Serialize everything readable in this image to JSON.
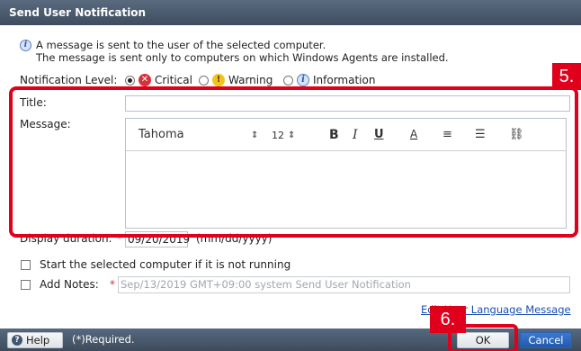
{
  "dialog": {
    "title": "Send User Notification"
  },
  "info": {
    "icon": "info-icon",
    "line1": "A message is sent to the user of the selected computer.",
    "line2": "The message is sent only to computers on which Windows Agents are installed."
  },
  "notification_level": {
    "label": "Notification Level:",
    "options": [
      {
        "label": "Critical",
        "icon": "critical-icon",
        "selected": true
      },
      {
        "label": "Warning",
        "icon": "warning-icon",
        "selected": false
      },
      {
        "label": "Information",
        "icon": "information-icon",
        "selected": false
      }
    ]
  },
  "title_field": {
    "label": "Title:",
    "value": ""
  },
  "message_field": {
    "label": "Message:",
    "toolbar": {
      "font": "Tahoma",
      "font_size": "12",
      "bold": "B",
      "italic": "I",
      "underline": "U",
      "font_color": "A",
      "align_glyph": "≡",
      "list_glyph": "☰",
      "link_glyph": "⛓"
    },
    "body": ""
  },
  "display_duration": {
    "label": "Display duration:",
    "required_mark": "*",
    "value": "09/20/2019",
    "format_hint": "(mm/dd/yyyy)"
  },
  "start_computer": {
    "label": "Start the selected computer if it is not running",
    "checked": false
  },
  "add_notes": {
    "label": "Add Notes:",
    "required_mark": "*",
    "placeholder": "Sep/13/2019 GMT+09:00 system Send User Notification"
  },
  "edit_language_link": "Edit User Language Message",
  "footer": {
    "help_label": "Help",
    "required_note": "(*)Required.",
    "ok_label": "OK",
    "cancel_label": "Cancel"
  },
  "annotations": {
    "step5": "5.",
    "step6": "6.",
    "color": "#e0001b"
  }
}
